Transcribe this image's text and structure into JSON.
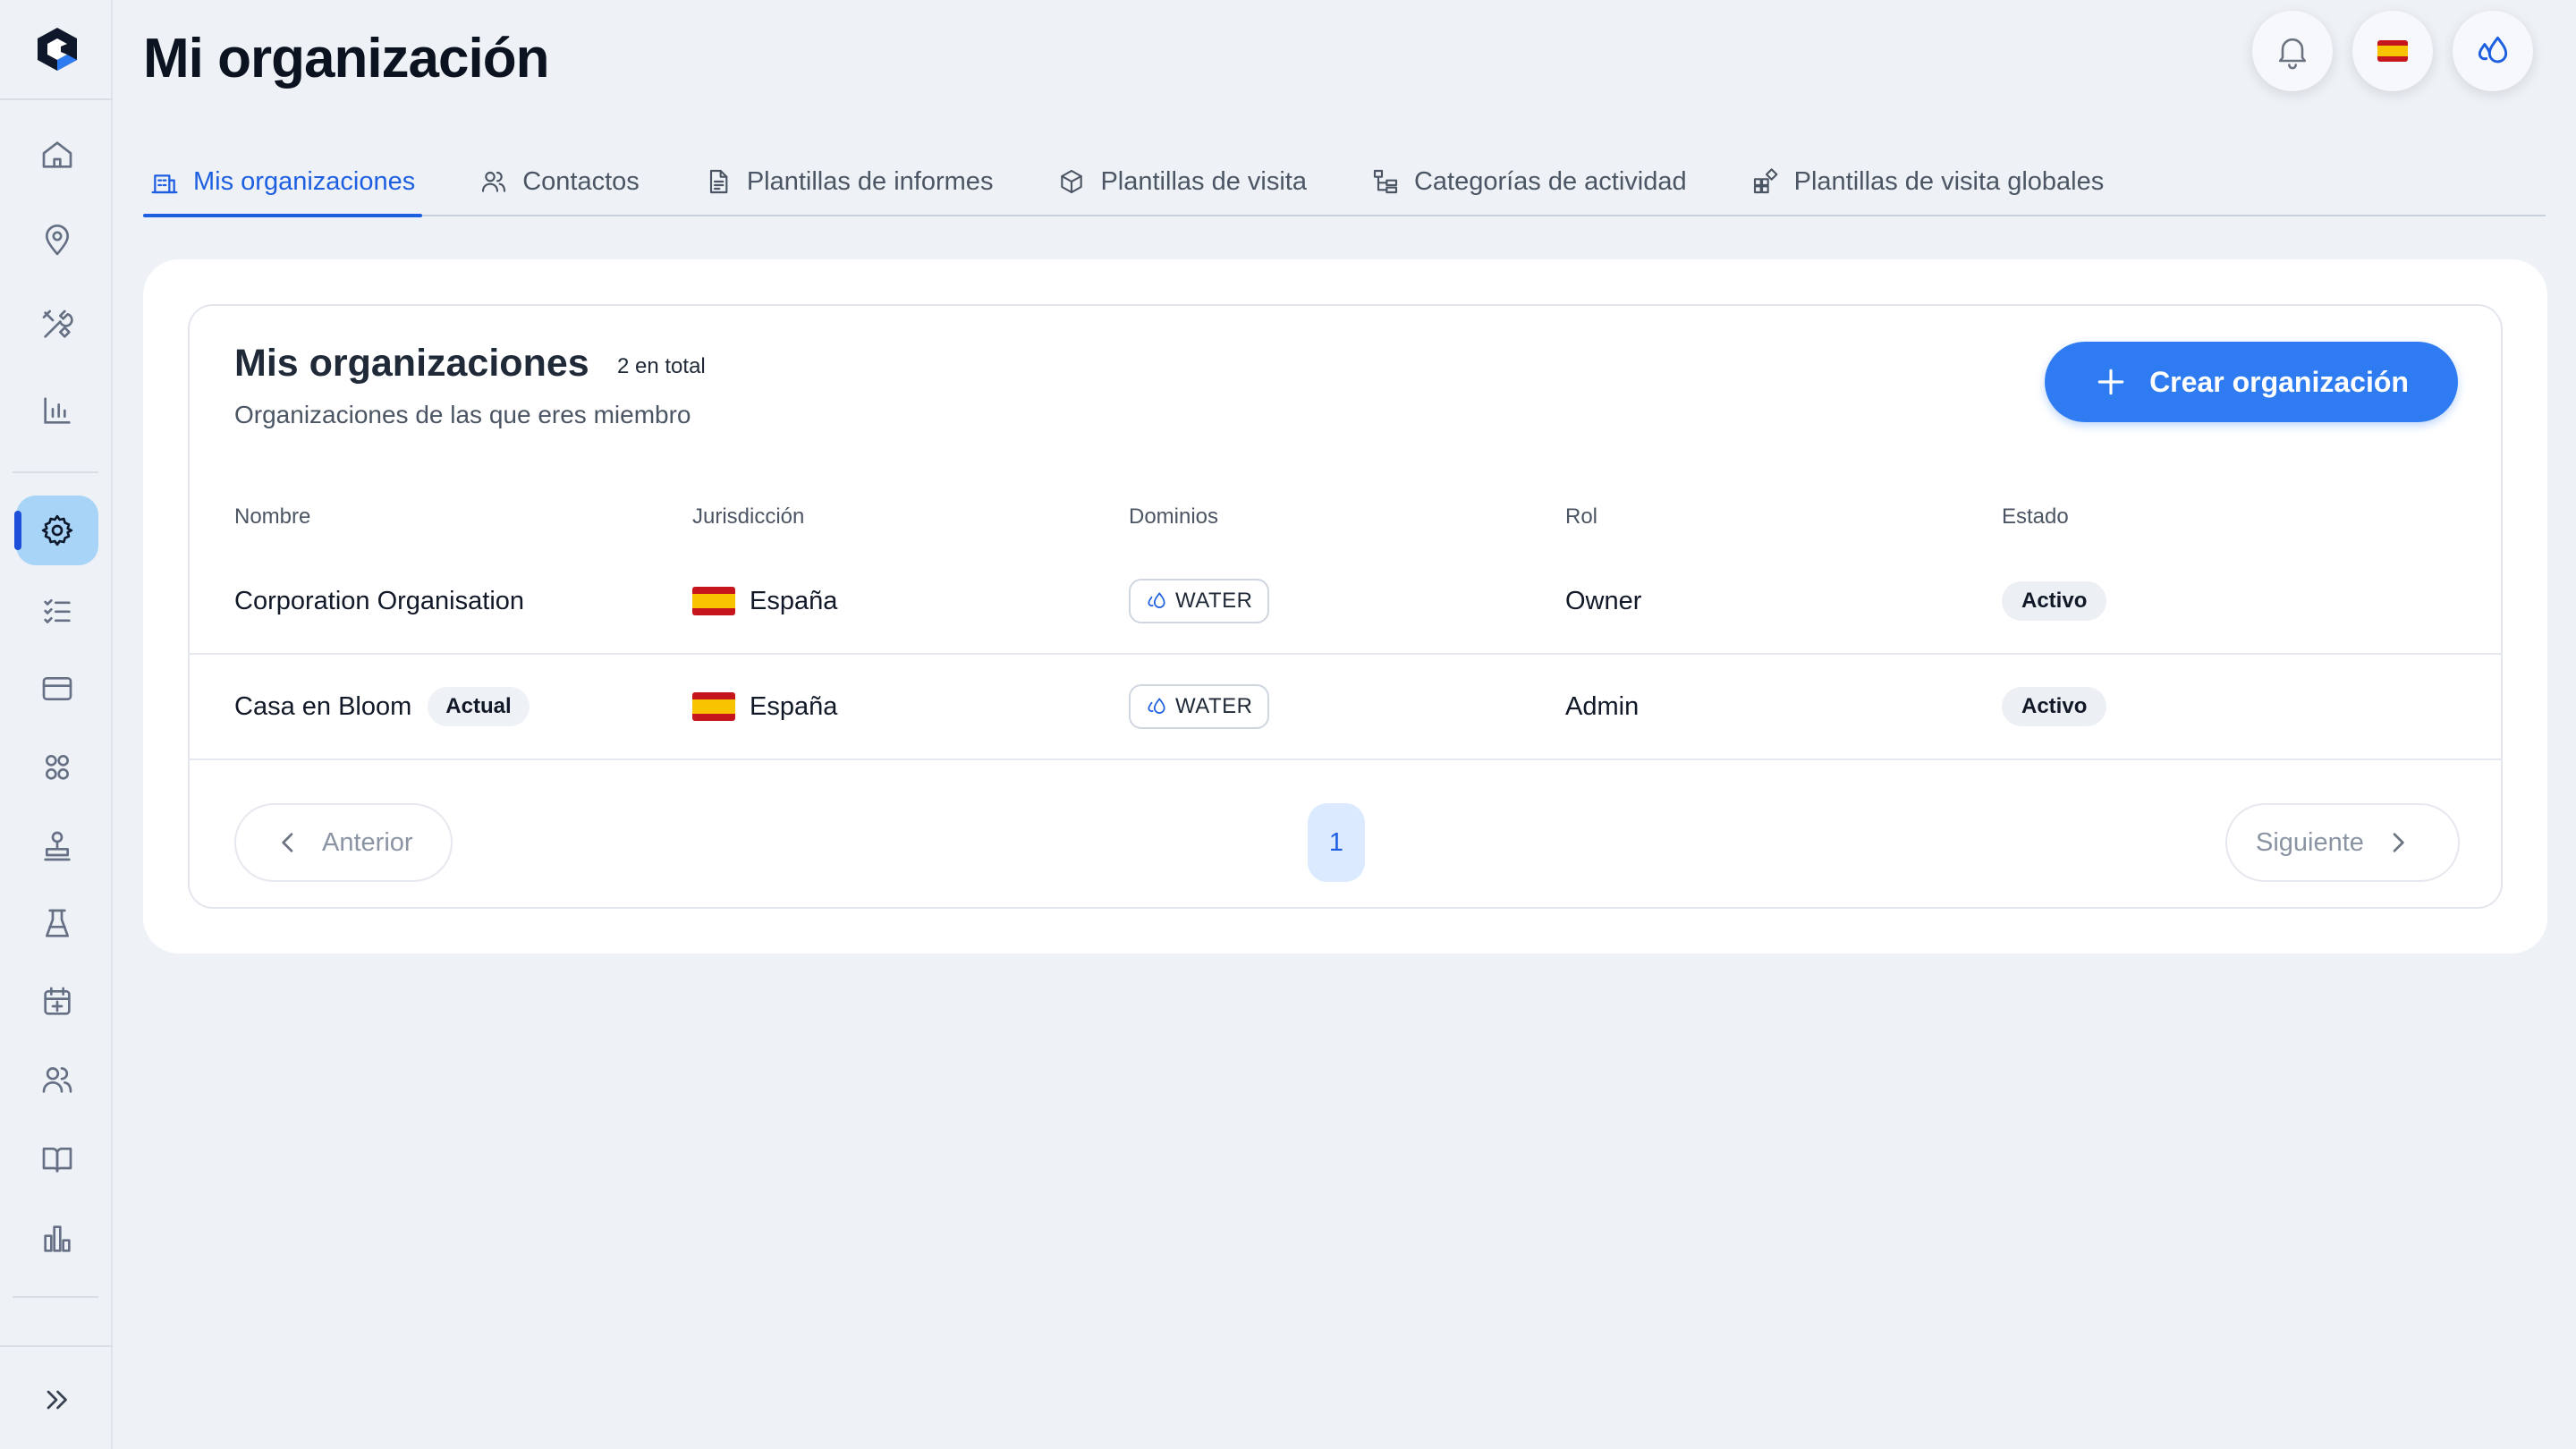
{
  "header": {
    "title": "Mi organización",
    "notifications_icon": "bell-icon",
    "language_flag": "🇪🇸",
    "domain_icon": "water-drops-icon"
  },
  "sidebar": {
    "items": [
      {
        "name": "home",
        "icon": "home-icon"
      },
      {
        "name": "locations",
        "icon": "map-pin-icon"
      },
      {
        "name": "tools",
        "icon": "tools-icon"
      },
      {
        "name": "analytics",
        "icon": "bar-chart-icon"
      },
      {
        "name": "settings",
        "icon": "gear-icon",
        "active": true
      },
      {
        "name": "tasks",
        "icon": "checklist-icon"
      },
      {
        "name": "billing",
        "icon": "credit-card-icon"
      },
      {
        "name": "groups",
        "icon": "team-icon"
      },
      {
        "name": "stamp",
        "icon": "stamp-icon"
      },
      {
        "name": "lab",
        "icon": "flask-icon"
      },
      {
        "name": "calendar",
        "icon": "calendar-icon"
      },
      {
        "name": "users",
        "icon": "users-icon"
      },
      {
        "name": "docs",
        "icon": "book-icon"
      },
      {
        "name": "reports",
        "icon": "stats-icon"
      }
    ]
  },
  "tabs": [
    {
      "label": "Mis organizaciones",
      "icon": "building-icon",
      "active": true
    },
    {
      "label": "Contactos",
      "icon": "contacts-icon"
    },
    {
      "label": "Plantillas de informes",
      "icon": "document-icon"
    },
    {
      "label": "Plantillas de visita",
      "icon": "box-icon"
    },
    {
      "label": "Categorías de actividad",
      "icon": "hierarchy-icon"
    },
    {
      "label": "Plantillas de visita globales",
      "icon": "widgets-icon"
    }
  ],
  "card": {
    "title": "Mis organizaciones",
    "count": "2 en total",
    "subtitle": "Organizaciones de las que eres miembro",
    "create_label": "Crear organización"
  },
  "table": {
    "columns": [
      "Nombre",
      "Jurisdicción",
      "Dominios",
      "Rol",
      "Estado"
    ],
    "rows": [
      {
        "name": "Corporation Organisation",
        "badge": "",
        "jurisdiction": "España",
        "domain": "WATER",
        "role": "Owner",
        "status": "Activo"
      },
      {
        "name": "Casa en Bloom",
        "badge": "Actual",
        "jurisdiction": "España",
        "domain": "WATER",
        "role": "Admin",
        "status": "Activo"
      }
    ]
  },
  "pagination": {
    "prev_label": "Anterior",
    "next_label": "Siguiente",
    "current_page": "1"
  },
  "colors": {
    "accent": "#1d5fe0",
    "primary_button": "#2f7cf2",
    "background": "#eef2f6"
  }
}
